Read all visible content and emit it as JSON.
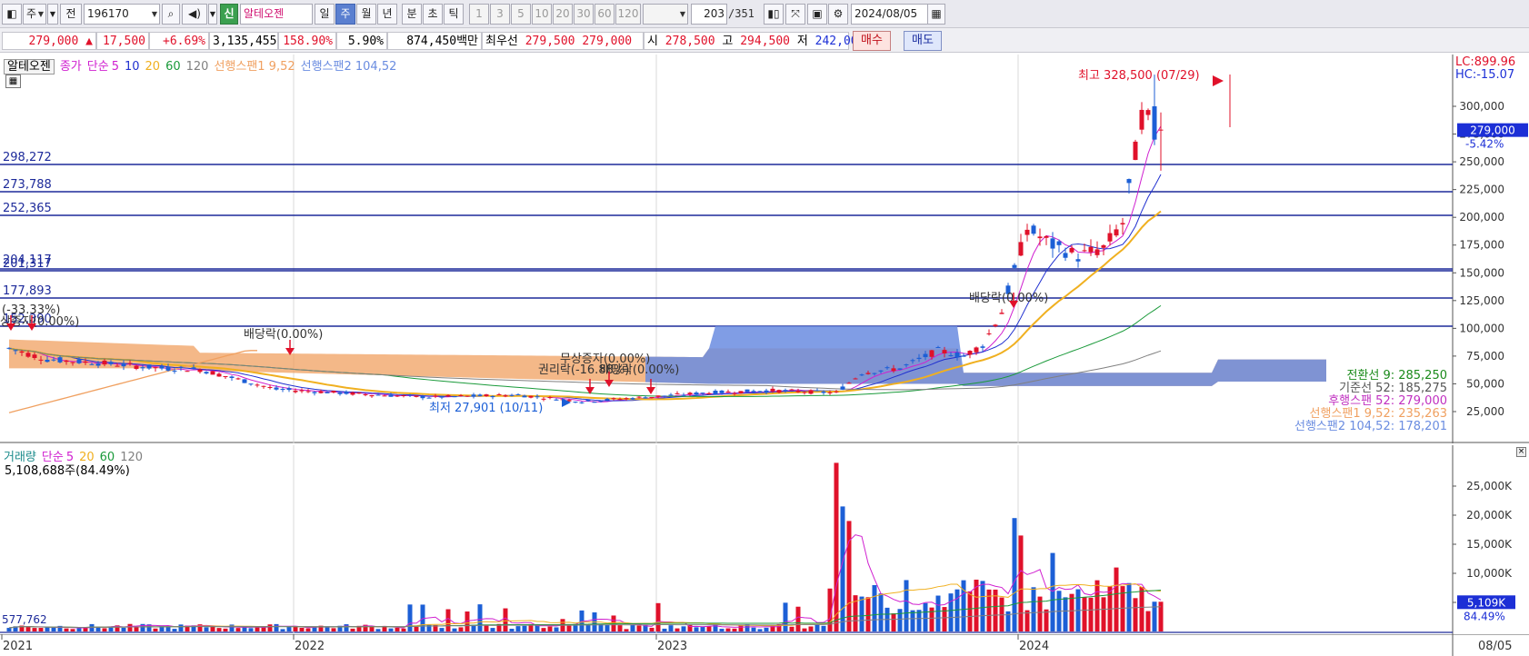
{
  "toolbar": {
    "unit_label": "주",
    "prev_label": "전",
    "code": "196170",
    "stock_badge": "신",
    "stock_name": "알테오젠",
    "periods": [
      "일",
      "주",
      "월",
      "년",
      "분",
      "초",
      "틱"
    ],
    "selected_period": "주",
    "intervals": [
      "1",
      "3",
      "5",
      "10",
      "20",
      "30",
      "60",
      "120"
    ],
    "count": "203",
    "total": "/351",
    "date": "2024/08/05"
  },
  "quote": {
    "price": "279,000",
    "change_arrow": "▲",
    "change": "17,500",
    "change_pct": "+6.69%",
    "volume": "3,135,455",
    "vol_ratio": "158.90%",
    "turnover": "5.90%",
    "amount": "874,450백만",
    "best_label": "최우선",
    "best_ask": "279,500",
    "best_bid": "279,000",
    "open_label": "시",
    "open": "278,500",
    "high_label": "고",
    "high": "294,500",
    "low_label": "저",
    "low": "242,000",
    "buy_label": "매수",
    "sell_label": "매도"
  },
  "price_legend": {
    "name": "알테오젠",
    "close_label": "종가",
    "ma_label": "단순",
    "ma": [
      "5",
      "10",
      "20",
      "60",
      "120"
    ],
    "span1": "선행스팬1 9,52",
    "span2": "선행스팬2 104,52"
  },
  "price_right": {
    "lc": "LC:899.96",
    "hc": "HC:-15.07",
    "current": "279,000",
    "current_pct": "-5.42%",
    "ticks": [
      "300,000",
      "275,000",
      "250,000",
      "225,000",
      "200,000",
      "175,000",
      "150,000",
      "125,000",
      "100,000",
      "75,000",
      "50,000",
      "25,000"
    ],
    "ichimoku": [
      {
        "text": "전환선 9: 285,250",
        "color": "#1a8a1a"
      },
      {
        "text": "기준선 52: 185,275",
        "color": "#555555"
      },
      {
        "text": "후행스팬 52: 279,000",
        "color": "#c030c0"
      },
      {
        "text": "선행스팬1 9,52: 235,263",
        "color": "#f0a060"
      },
      {
        "text": "선행스팬2 104,52: 178,201",
        "color": "#6a8ce0"
      }
    ]
  },
  "price_levels": [
    "298,272",
    "273,788",
    "252,365",
    "204,117",
    "201,317",
    "177,893",
    "152,390"
  ],
  "annotations": {
    "high": "최고 328,500 (07/29)",
    "low": "최저 27,901 (10/11)",
    "div1": "배당락(0.00%)",
    "div2": "배당락(0.00%)",
    "split": "(-33.33%)",
    "capinc": "상증자(0.00%)",
    "rights1": "무상증자(0.00%)",
    "rights2": "권리락(-16.88%)",
    "rights3": "배당락(0.00%)"
  },
  "volume_legend": {
    "name": "거래량",
    "ma_label": "단순",
    "ma": [
      "5",
      "20",
      "60",
      "120"
    ],
    "current": "5,108,688주(84.49%)",
    "left_value": "577,762"
  },
  "volume_right": {
    "ticks": [
      "25,000K",
      "20,000K",
      "15,000K",
      "10,000K",
      "5,000K"
    ],
    "current": "5,109K",
    "current_pct": "84.49%"
  },
  "x_axis": {
    "years": [
      "2021",
      "2022",
      "2023",
      "2024"
    ],
    "last_date": "08/05"
  },
  "colors": {
    "up": "#e0112a",
    "down": "#1c5fd6",
    "ma5": "#d020d0",
    "ma10": "#2030d0",
    "ma20": "#f0b020",
    "ma60": "#1a9a3a",
    "ma120": "#808080",
    "span1": "#f0a060",
    "span2": "#6a8ce0"
  }
}
